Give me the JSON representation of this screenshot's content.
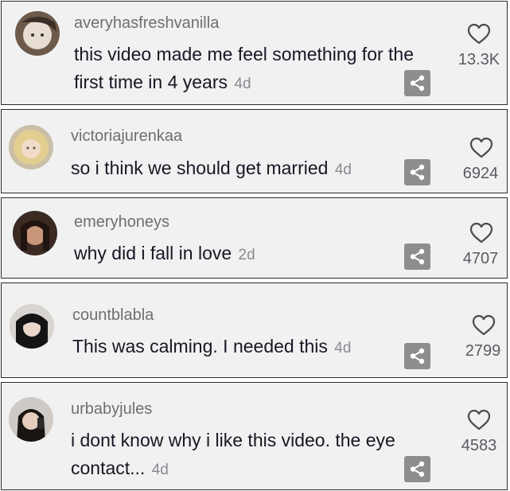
{
  "comments": [
    {
      "username": "averyhasfreshvanilla",
      "text": "this video made me feel something for the first time in 4 years",
      "time": "4d",
      "likes": "13.3K",
      "avatar_icon": "avatar-photo"
    },
    {
      "username": "victoriajurenkaa",
      "text": "so i think we should get married",
      "time": "4d",
      "likes": "6924",
      "avatar_icon": "avatar-photo"
    },
    {
      "username": "emeryhoneys",
      "text": "why did i fall in love",
      "time": "2d",
      "likes": "4707",
      "avatar_icon": "avatar-photo"
    },
    {
      "username": "countblabla",
      "text": "This was calming. I needed this",
      "time": "4d",
      "likes": "2799",
      "avatar_icon": "avatar-photo"
    },
    {
      "username": "urbabyjules",
      "text": "i dont know why i like this video. the eye contact...",
      "time": "4d",
      "likes": "4583",
      "avatar_icon": "avatar-photo"
    }
  ],
  "icons": {
    "like": "heart-icon",
    "share": "share-icon"
  },
  "colors": {
    "card_background": "#f1f1f2",
    "username": "#6f6f73",
    "comment_text": "#161823",
    "share_button": "#8d8d8f"
  }
}
